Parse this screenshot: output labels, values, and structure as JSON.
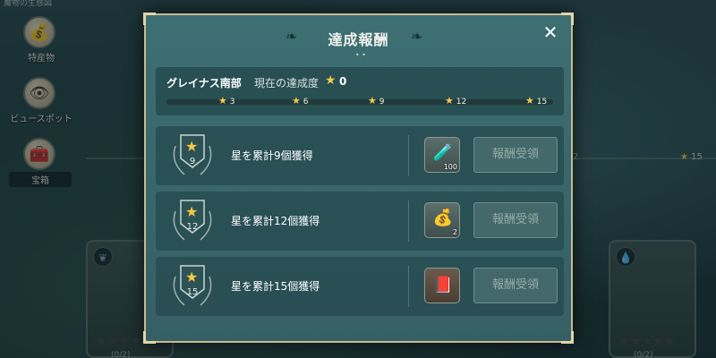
{
  "background": {
    "top_strip": "魔物の生態図",
    "nav": [
      {
        "label": "特産物",
        "icon": "money-bag-icon",
        "glyph": "💰"
      },
      {
        "label": "ビュースポット",
        "icon": "binoculars-icon",
        "glyph": "👁"
      },
      {
        "label": "宝箱",
        "icon": "treasure-chest-icon",
        "glyph": "🧰"
      }
    ],
    "milestone_fragment": "2",
    "milestone_end": "15",
    "card_count": "(0/2)"
  },
  "modal": {
    "title": "達成報酬",
    "close_glyph": "✕",
    "region_name": "グレイナス南部",
    "current_label": "現在の達成度",
    "current_value": "0",
    "progress_fraction": 0,
    "milestones": [
      "3",
      "6",
      "9",
      "12",
      "15"
    ],
    "rewards": [
      {
        "badge_number": "9",
        "description": "星を累計9個獲得",
        "reward_icon": "potion-icon",
        "reward_glyph": "🧪",
        "reward_qty": "100",
        "button_label": "報酬受領"
      },
      {
        "badge_number": "12",
        "description": "星を累計12個獲得",
        "reward_icon": "gold-coins-icon",
        "reward_glyph": "💰",
        "reward_qty": "2",
        "button_label": "報酬受領"
      },
      {
        "badge_number": "15",
        "description": "星を累計15個獲得",
        "reward_icon": "recipe-book-icon",
        "reward_glyph": "📕",
        "reward_qty": "",
        "button_label": "報酬受領"
      }
    ]
  },
  "colors": {
    "accent_gold": "#f2c94c",
    "panel_teal": "#355f64",
    "border_gold": "#c9b98f"
  }
}
